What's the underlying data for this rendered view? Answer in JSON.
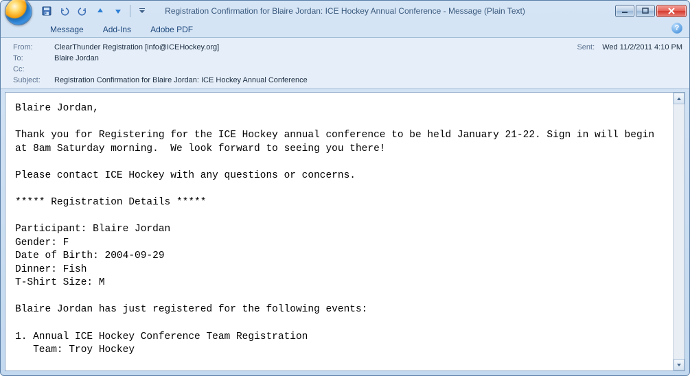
{
  "window": {
    "title": "Registration Confirmation for Blaire Jordan: ICE Hockey Annual Conference - Message (Plain Text)"
  },
  "qat": {
    "save": "save-icon",
    "undo": "undo-icon",
    "redo": "redo-icon",
    "prev": "prev-icon",
    "next": "next-icon"
  },
  "ribbon": {
    "tabs": [
      {
        "label": "Message"
      },
      {
        "label": "Add-Ins"
      },
      {
        "label": "Adobe PDF"
      }
    ]
  },
  "header": {
    "from_label": "From:",
    "from_value": "ClearThunder Registration [info@ICEHockey.org]",
    "to_label": "To:",
    "to_value": "Blaire Jordan",
    "cc_label": "Cc:",
    "cc_value": "",
    "subject_label": "Subject:",
    "subject_value": "Registration Confirmation for Blaire Jordan: ICE Hockey Annual Conference",
    "sent_label": "Sent:",
    "sent_value": "Wed 11/2/2011 4:10 PM"
  },
  "body": "Blaire Jordan,\n\nThank you for Registering for the ICE Hockey annual conference to be held January 21-22. Sign in will begin at 8am Saturday morning.  We look forward to seeing you there!\n\nPlease contact ICE Hockey with any questions or concerns.\n\n***** Registration Details *****\n\nParticipant: Blaire Jordan\nGender: F\nDate of Birth: 2004-09-29\nDinner: Fish\nT-Shirt Size: M\n\nBlaire Jordan has just registered for the following events:\n\n1. Annual ICE Hockey Conference Team Registration\n   Team: Troy Hockey"
}
